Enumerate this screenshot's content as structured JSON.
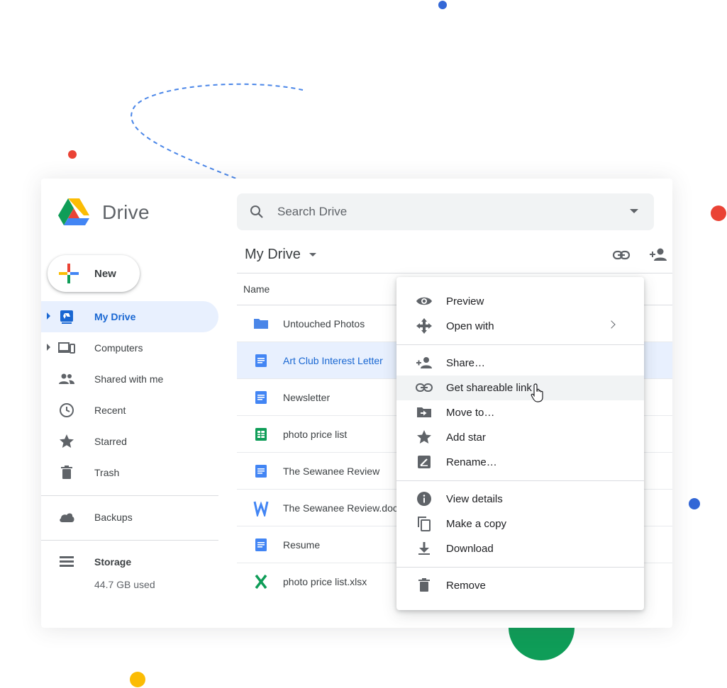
{
  "app": {
    "name": "Drive"
  },
  "search": {
    "placeholder": "Search Drive"
  },
  "new_button": {
    "label": "New"
  },
  "sidebar": {
    "items": [
      {
        "label": "My Drive",
        "icon": "my-drive-icon",
        "active": true,
        "expandable": true
      },
      {
        "label": "Computers",
        "icon": "computers-icon",
        "active": false,
        "expandable": true
      },
      {
        "label": "Shared with me",
        "icon": "shared-with-me-icon",
        "active": false,
        "expandable": false
      },
      {
        "label": "Recent",
        "icon": "clock-icon",
        "active": false,
        "expandable": false
      },
      {
        "label": "Starred",
        "icon": "star-icon",
        "active": false,
        "expandable": false
      },
      {
        "label": "Trash",
        "icon": "trash-icon",
        "active": false,
        "expandable": false
      }
    ],
    "backups": {
      "label": "Backups",
      "icon": "cloud-icon"
    },
    "storage": {
      "label": "Storage",
      "icon": "storage-icon",
      "used": "44.7 GB used"
    }
  },
  "main": {
    "title": "My Drive",
    "column_name": "Name",
    "files": [
      {
        "name": "Untouched Photos",
        "type": "folder",
        "selected": false
      },
      {
        "name": "Art Club Interest Letter",
        "type": "doc",
        "selected": true
      },
      {
        "name": "Newsletter",
        "type": "doc",
        "selected": false
      },
      {
        "name": "photo price list",
        "type": "sheet",
        "selected": false
      },
      {
        "name": "The Sewanee Review",
        "type": "doc",
        "selected": false
      },
      {
        "name": "The Sewanee Review.doc",
        "type": "word",
        "selected": false
      },
      {
        "name": "Resume",
        "type": "doc",
        "selected": false
      },
      {
        "name": "photo price list.xlsx",
        "type": "excel",
        "selected": false
      }
    ]
  },
  "context_menu": {
    "groups": [
      [
        {
          "label": "Preview",
          "icon": "eye-icon"
        },
        {
          "label": "Open with",
          "icon": "open-with-icon",
          "submenu": true
        }
      ],
      [
        {
          "label": "Share…",
          "icon": "add-person-icon"
        },
        {
          "label": "Get shareable link",
          "icon": "link-icon",
          "highlighted": true
        },
        {
          "label": "Move to…",
          "icon": "move-to-icon"
        },
        {
          "label": "Add star",
          "icon": "star-icon"
        },
        {
          "label": "Rename…",
          "icon": "rename-icon"
        }
      ],
      [
        {
          "label": "View details",
          "icon": "info-icon"
        },
        {
          "label": "Make a copy",
          "icon": "copy-icon"
        },
        {
          "label": "Download",
          "icon": "download-icon"
        }
      ],
      [
        {
          "label": "Remove",
          "icon": "trash-icon"
        }
      ]
    ]
  },
  "colors": {
    "accent": "#1967d2",
    "selected_bg": "#e8f0fe",
    "doc_blue": "#4285f4",
    "sheet_green": "#0f9d58",
    "deco_red": "#ea4335",
    "deco_blue": "#3367d6",
    "deco_yellow": "#fbbc04",
    "deco_green": "#0f9d58"
  }
}
